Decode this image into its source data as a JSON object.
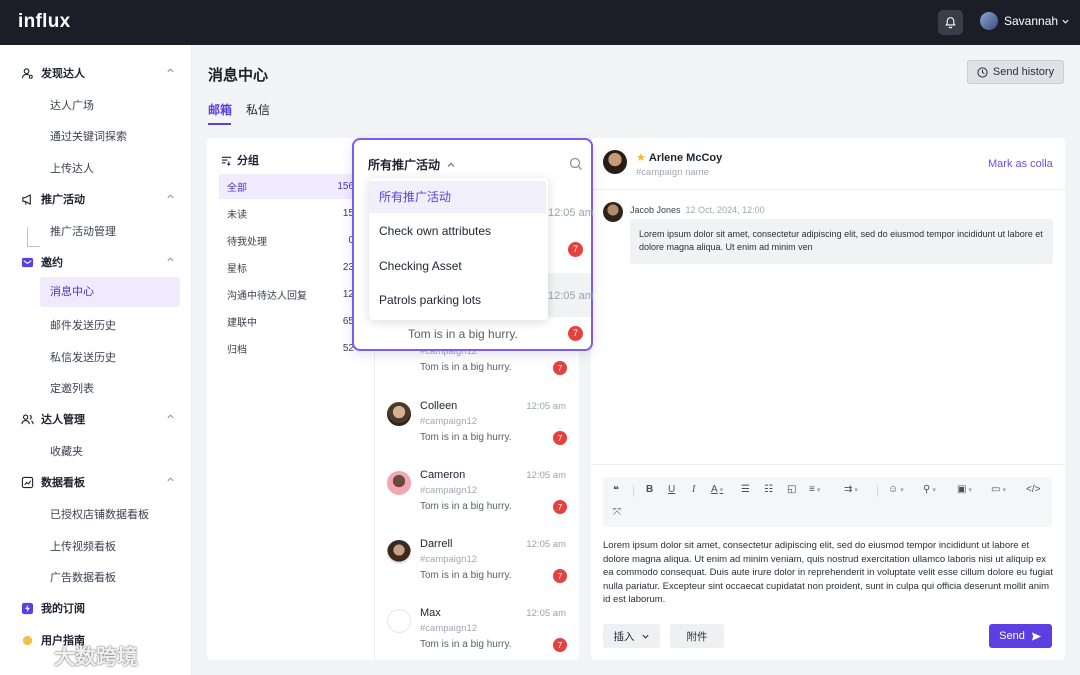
{
  "app": {
    "logo": "influx",
    "user_name": "Savannah"
  },
  "sidebar": {
    "groups": [
      {
        "label": "发现达人",
        "items": [
          "达人广场",
          "通过关键词探索",
          "上传达人"
        ]
      },
      {
        "label": "推广活动",
        "items": [
          "推广活动管理"
        ]
      },
      {
        "label": "邀约",
        "items": [
          "消息中心",
          "邮件发送历史",
          "私信发送历史",
          "定邀列表"
        ]
      },
      {
        "label": "达人管理",
        "items": [
          "收藏夹"
        ]
      },
      {
        "label": "数据看板",
        "items": [
          "已授权店铺数据看板",
          "上传视频看板",
          "广告数据看板"
        ]
      },
      {
        "label": "我的订阅",
        "items": []
      },
      {
        "label": "用户指南",
        "items": []
      }
    ],
    "accent": "#5b3fe0"
  },
  "header": {
    "title": "消息中心",
    "send_history": "Send history",
    "tabs": [
      "邮箱",
      "私信"
    ]
  },
  "folders": {
    "title": "分组",
    "items": [
      {
        "label": "全部",
        "count": "156"
      },
      {
        "label": "未读",
        "count": "15"
      },
      {
        "label": "待我处理",
        "count": "0"
      },
      {
        "label": "星标",
        "count": "23"
      },
      {
        "label": "沟通中待达人回复",
        "count": "12"
      },
      {
        "label": "建联中",
        "count": "65"
      },
      {
        "label": "归档",
        "count": "52"
      }
    ]
  },
  "dropdown": {
    "title": "所有推广活动",
    "options": [
      "所有推广活动",
      "Check own attributes",
      "Checking Asset",
      "Patrols parking lots"
    ],
    "selected": "所有推广活动",
    "peek": {
      "time1": "12:05 am",
      "badge1": "7",
      "time2": "12:05 am",
      "msg": "Tom is in a big hurry.",
      "badge2": "7"
    }
  },
  "conversations": [
    {
      "name": "",
      "camp": "#campaign12",
      "msg": "Tom is in a big hurry.",
      "time": "",
      "badge": "7"
    },
    {
      "name": "Colleen",
      "camp": "#campaign12",
      "msg": "Tom is in a big hurry.",
      "time": "12:05 am",
      "badge": "7"
    },
    {
      "name": "Cameron",
      "camp": "#campaign12",
      "msg": "Tom is in a big hurry.",
      "time": "12:05 am",
      "badge": "7"
    },
    {
      "name": "Darrell",
      "camp": "#campaign12",
      "msg": "Tom is in a big hurry.",
      "time": "12:05 am",
      "badge": "7"
    },
    {
      "name": "Max",
      "camp": "#campaign12",
      "msg": "Tom is in a big hurry.",
      "time": "12:05 am",
      "badge": "7"
    }
  ],
  "chat": {
    "contact_name": "Arlene McCoy",
    "contact_campaign": "#campaign name",
    "mark_link": "Mark as colla",
    "sender": "Jacob Jones",
    "date": "12 Oct, 2024, 12:00",
    "message": "Lorem ipsum dolor sit amet, consectetur adipiscing elit, sed do eiusmod tempor incididunt ut labore et dolore magna aliqua. Ut enim ad minim ven",
    "compose_text": "Lorem ipsum dolor sit amet, consectetur adipiscing elit, sed do eiusmod tempor incididunt ut labore et dolore magna aliqua. Ut enim ad minim veniam, quis nostrud exercitation ullamco laboris nisi ut aliquip ex ea commodo consequat. Duis aute irure dolor in reprehenderit in voluptate velit esse cillum dolore eu fugiat nulla pariatur. Excepteur sint occaecat cupidatat non proident, sunt in culpa qui officia deserunt mollit anim id est laborum.",
    "insert_label": "插入",
    "attach_label": "附件",
    "send_label": "Send"
  },
  "watermark": "大数跨境"
}
